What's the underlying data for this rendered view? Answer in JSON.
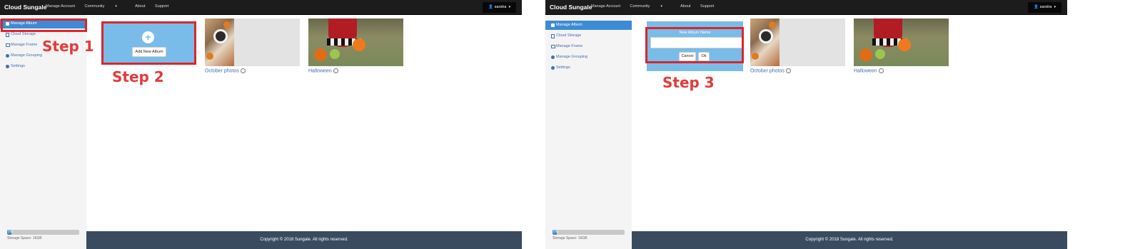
{
  "panels": [
    {
      "navbar": {
        "brand": "Cloud Sungale",
        "items": [
          "Manage Account",
          "Community",
          "About",
          "Support"
        ],
        "user": "sandra"
      },
      "sidebar": {
        "items": [
          {
            "label": "Manage Album",
            "icon": "camera-icon"
          },
          {
            "label": "Cloud Storage",
            "icon": "file-icon"
          },
          {
            "label": "Manage Frame",
            "icon": "image-icon"
          },
          {
            "label": "Manage Grouping",
            "icon": "users-icon"
          },
          {
            "label": "Settings",
            "icon": "gear-icon"
          }
        ],
        "storage_percent": "0%",
        "storage_fraction": 0.06,
        "storage_text": "Storage Space: 16GB"
      },
      "main": {
        "add_button": "Add New Album",
        "albums": [
          {
            "caption": "October photos"
          },
          {
            "caption": "Halloween"
          }
        ]
      },
      "footer": "Copyright © 2018 Sungale. All rights reserved.",
      "annotations": [
        "Step 1",
        "Step 2"
      ]
    },
    {
      "navbar": {
        "brand": "Cloud Sungale",
        "items": [
          "Manage Account",
          "Community",
          "About",
          "Support"
        ],
        "user": "sandra"
      },
      "sidebar": {
        "items": [
          {
            "label": "Manage Album",
            "icon": "camera-icon"
          },
          {
            "label": "Cloud Storage",
            "icon": "file-icon"
          },
          {
            "label": "Manage Frame",
            "icon": "image-icon"
          },
          {
            "label": "Manage Grouping",
            "icon": "users-icon"
          },
          {
            "label": "Settings",
            "icon": "gear-icon"
          }
        ],
        "storage_percent": "0%",
        "storage_fraction": 0.06,
        "storage_text": "Storage Space: 16GB"
      },
      "main": {
        "new_album_label": "New Album Name",
        "input_value": "",
        "cancel_button": "Cancel",
        "ok_button": "Ok",
        "albums": [
          {
            "caption": "October photos"
          },
          {
            "caption": "Halloween"
          }
        ]
      },
      "footer": "Copyright © 2018 Sungale. All rights reserved.",
      "annotations": [
        "Step 3"
      ]
    }
  ],
  "colors": {
    "navbar": "#1c1c1c",
    "accent": "#3d8bd4",
    "tile": "#79bce9",
    "footer": "#3a4a5f",
    "annotation": "#e23b3b"
  }
}
